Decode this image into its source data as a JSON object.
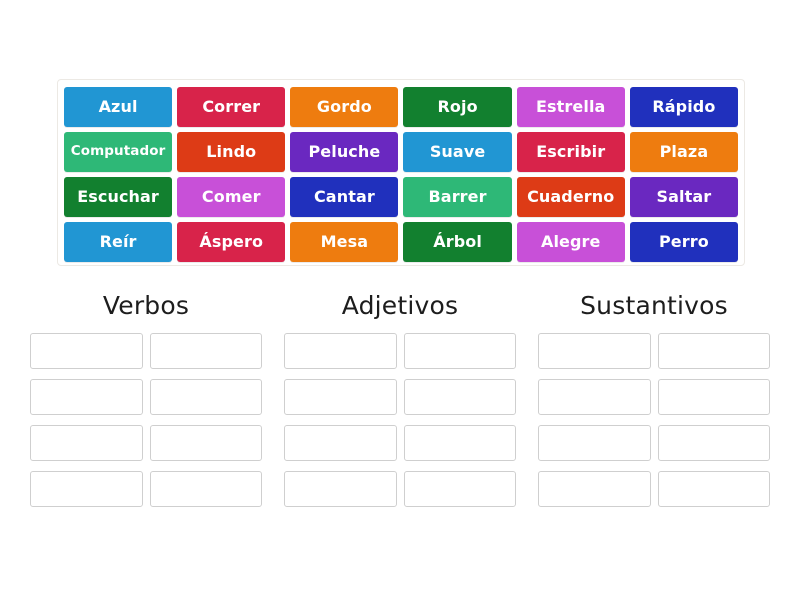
{
  "activity": {
    "type": "group-sort",
    "word_bank": {
      "tiles": [
        {
          "label": "Azul",
          "color": "#2196d3",
          "size": "normal"
        },
        {
          "label": "Correr",
          "color": "#d8234a",
          "size": "normal"
        },
        {
          "label": "Gordo",
          "color": "#ee7c0f",
          "size": "normal"
        },
        {
          "label": "Rojo",
          "color": "#12802f",
          "size": "normal"
        },
        {
          "label": "Estrella",
          "color": "#c850d8",
          "size": "normal"
        },
        {
          "label": "Rápido",
          "color": "#2030bd",
          "size": "normal"
        },
        {
          "label": "Computador",
          "color": "#2eb877",
          "size": "small"
        },
        {
          "label": "Lindo",
          "color": "#dd3b16",
          "size": "normal"
        },
        {
          "label": "Peluche",
          "color": "#6a28c0",
          "size": "normal"
        },
        {
          "label": "Suave",
          "color": "#2196d3",
          "size": "normal"
        },
        {
          "label": "Escribir",
          "color": "#d8234a",
          "size": "normal"
        },
        {
          "label": "Plaza",
          "color": "#ee7c0f",
          "size": "normal"
        },
        {
          "label": "Escuchar",
          "color": "#12802f",
          "size": "normal"
        },
        {
          "label": "Comer",
          "color": "#c850d8",
          "size": "normal"
        },
        {
          "label": "Cantar",
          "color": "#2030bd",
          "size": "normal"
        },
        {
          "label": "Barrer",
          "color": "#2eb877",
          "size": "normal"
        },
        {
          "label": "Cuaderno",
          "color": "#dd3b16",
          "size": "normal"
        },
        {
          "label": "Saltar",
          "color": "#6a28c0",
          "size": "normal"
        },
        {
          "label": "Reír",
          "color": "#2196d3",
          "size": "normal"
        },
        {
          "label": "Áspero",
          "color": "#d8234a",
          "size": "normal"
        },
        {
          "label": "Mesa",
          "color": "#ee7c0f",
          "size": "normal"
        },
        {
          "label": "Árbol",
          "color": "#12802f",
          "size": "normal"
        },
        {
          "label": "Alegre",
          "color": "#c850d8",
          "size": "normal"
        },
        {
          "label": "Perro",
          "color": "#2030bd",
          "size": "normal"
        }
      ]
    },
    "categories": [
      {
        "title": "Verbos",
        "slot_count": 8,
        "slots": [
          "",
          "",
          "",
          "",
          "",
          "",
          "",
          ""
        ]
      },
      {
        "title": "Adjetivos",
        "slot_count": 8,
        "slots": [
          "",
          "",
          "",
          "",
          "",
          "",
          "",
          ""
        ]
      },
      {
        "title": "Sustantivos",
        "slot_count": 8,
        "slots": [
          "",
          "",
          "",
          "",
          "",
          "",
          "",
          ""
        ]
      }
    ],
    "colors": {
      "background": "#ffffff",
      "bank_border": "#ece9e4",
      "slot_border": "#cfcfcf",
      "title_text": "#1d1d1d",
      "tile_text": "#ffffff"
    }
  }
}
